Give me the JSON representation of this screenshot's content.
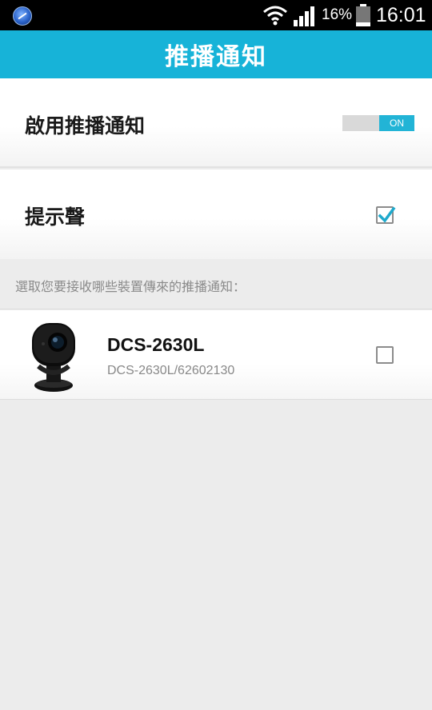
{
  "status_bar": {
    "battery_percent": "16%",
    "time": "16:01",
    "icons": [
      "app-icon",
      "wifi-icon",
      "signal-icon",
      "battery-icon"
    ]
  },
  "app_bar": {
    "title": "推播通知",
    "color": "#17b3d8"
  },
  "settings": {
    "enable_push": {
      "label": "啟用推播通知",
      "toggle_text": "ON",
      "enabled": true
    },
    "sound": {
      "label": "提示聲",
      "checked": true
    }
  },
  "devices_section": {
    "header": "選取您要接收哪些裝置傳來的推播通知："
  },
  "devices": [
    {
      "name": "DCS-2630L",
      "id": "DCS-2630L/62602130",
      "icon": "camera-icon",
      "checked": false
    }
  ]
}
